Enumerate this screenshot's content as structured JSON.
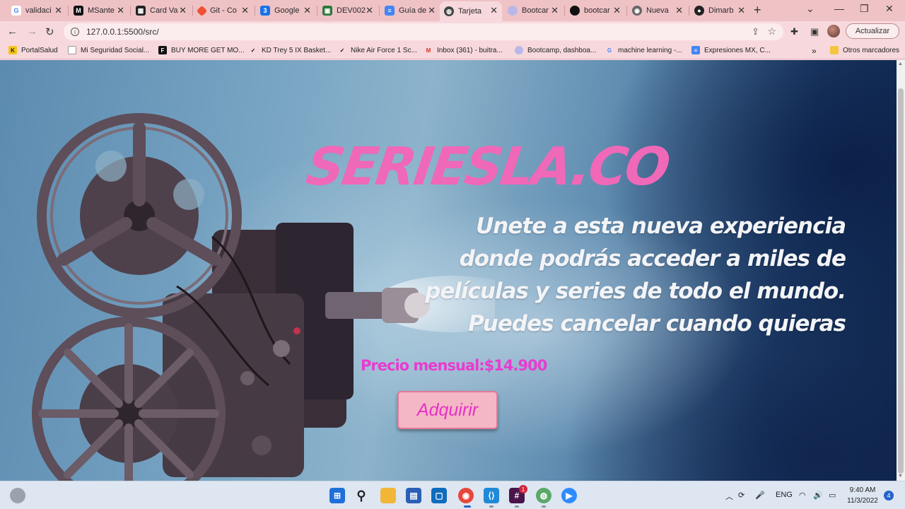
{
  "browser": {
    "tabs": [
      {
        "title": "validaci",
        "icon": "google-icon"
      },
      {
        "title": "MSante",
        "icon": "m-icon"
      },
      {
        "title": "Card Va",
        "icon": "card-icon"
      },
      {
        "title": "Git - Co",
        "icon": "git-icon"
      },
      {
        "title": "Google",
        "icon": "google-calendar-icon"
      },
      {
        "title": "DEV002",
        "icon": "dev-icon"
      },
      {
        "title": "Guía de",
        "icon": "docs-icon"
      },
      {
        "title": "Tarjeta",
        "icon": "globe-icon",
        "active": true
      },
      {
        "title": "Bootcar",
        "icon": "bootcamp-icon"
      },
      {
        "title": "bootcar",
        "icon": "circle-icon"
      },
      {
        "title": "Nueva",
        "icon": "chrome-icon"
      },
      {
        "title": "Dimarb",
        "icon": "github-icon"
      }
    ],
    "url": "127.0.0.1:5500/src/",
    "update_label": "Actualizar",
    "bookmarks": [
      {
        "label": "PortalSalud"
      },
      {
        "label": "Mi Seguridad Social..."
      },
      {
        "label": "BUY MORE GET MO..."
      },
      {
        "label": "KD Trey 5 IX Basket..."
      },
      {
        "label": "Nike Air Force 1 Sc..."
      },
      {
        "label": "Inbox (361) - buitra..."
      },
      {
        "label": "Bootcamp, dashboa..."
      },
      {
        "label": "machine learning -..."
      },
      {
        "label": "Expresiones MX, C..."
      }
    ],
    "bookmarks_more": "»",
    "other_bookmarks": "Otros marcadores"
  },
  "page": {
    "brand": "SERIESLA.CO",
    "pitch_lines": [
      "Unete a esta nueva experiencia",
      "donde podrás acceder a miles de",
      "películas y series de todo el mundo.",
      "Puedes cancelar cuando quieras"
    ],
    "price": "Precio mensual:$14.900",
    "buy_label": "Adquirir",
    "colors": {
      "brand": "#f068b8",
      "price": "#e83ccf",
      "button_bg": "#f4b7c5"
    }
  },
  "taskbar": {
    "language": "ENG",
    "time": "9:40 AM",
    "date": "11/3/2022",
    "notifications": "4",
    "slack_badge": "1"
  }
}
